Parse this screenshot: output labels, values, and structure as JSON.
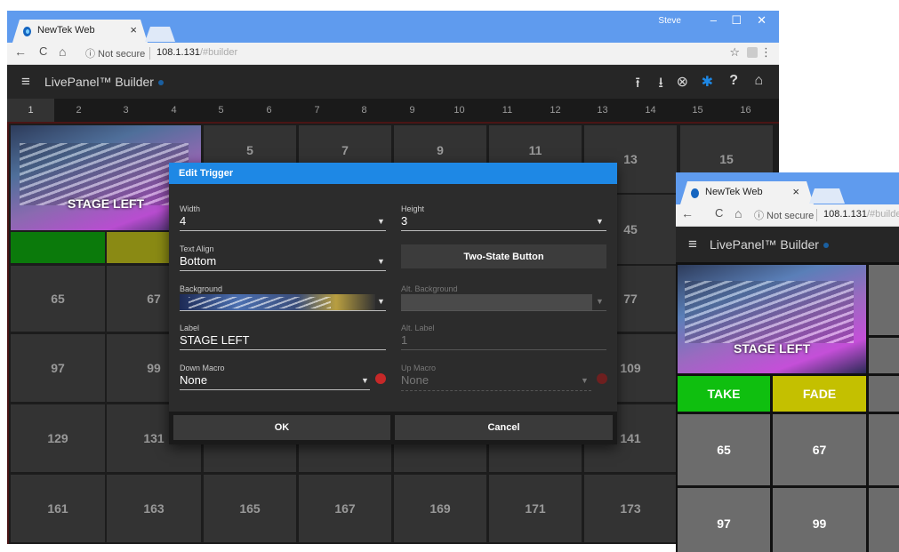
{
  "browser": {
    "tab_title": "NewTek Web",
    "tab_close": "×",
    "user": "Steve",
    "minimize": "–",
    "maximize": "☐",
    "close": "✕",
    "back": "←",
    "forward": "→",
    "reload": "C",
    "home": "⌂",
    "security": "ⓘ Not secure",
    "url_host": "108.1.131",
    "url_hash": "/#builder",
    "bookmark": "☆",
    "menu": "⋮"
  },
  "app": {
    "menu_icon": "≡",
    "title": "LivePanel™ Builder",
    "header_icons": [
      "upload-icon",
      "download-icon",
      "history-icon",
      "settings-icon",
      "help-icon",
      "home-icon"
    ],
    "header_glyphs": [
      "⭱",
      "⭳",
      "⊗",
      "✱",
      "?",
      "⌂"
    ],
    "accent": "#1e88e5"
  },
  "page_tabs": [
    "1",
    "2",
    "3",
    "4",
    "5",
    "6",
    "7",
    "8",
    "9",
    "10",
    "11",
    "12",
    "13",
    "14",
    "15",
    "16"
  ],
  "grid": {
    "large_button_label": "STAGE LEFT",
    "row1": [
      "5",
      "7",
      "9",
      "11",
      "13",
      "15"
    ],
    "row2_right": "45",
    "row3": [
      "65",
      "67",
      "77"
    ],
    "row4": [
      "97",
      "99",
      "109"
    ],
    "row5": [
      "129",
      "131",
      "141"
    ],
    "row6": [
      "161",
      "163",
      "165",
      "167",
      "169",
      "171",
      "173"
    ]
  },
  "dialog": {
    "title": "Edit Trigger",
    "width_label": "Width",
    "width_value": "4",
    "height_label": "Height",
    "height_value": "3",
    "text_align_label": "Text Align",
    "text_align_value": "Bottom",
    "two_state_button": "Two-State Button",
    "background_label": "Background",
    "alt_background_label": "Alt. Background",
    "label_label": "Label",
    "label_value": "STAGE LEFT",
    "alt_label_label": "Alt. Label",
    "alt_label_value": "1",
    "down_macro_label": "Down Macro",
    "down_macro_value": "None",
    "up_macro_label": "Up Macro",
    "up_macro_value": "None",
    "ok": "OK",
    "cancel": "Cancel"
  },
  "panel2": {
    "tab_title": "NewTek Web",
    "tab_close": "×",
    "back": "←",
    "forward": "→",
    "reload": "C",
    "home": "⌂",
    "security": "ⓘ Not secure",
    "url_host": "108.1.131",
    "url_hash": "/#builder",
    "menu_icon": "≡",
    "title": "LivePanel™ Builder",
    "large_button_label": "STAGE LEFT",
    "take": "TAKE",
    "fade": "FADE",
    "take_color": "#0fbf0f",
    "fade_color": "#c4c000",
    "cells": [
      "65",
      "67",
      "97",
      "99"
    ]
  }
}
